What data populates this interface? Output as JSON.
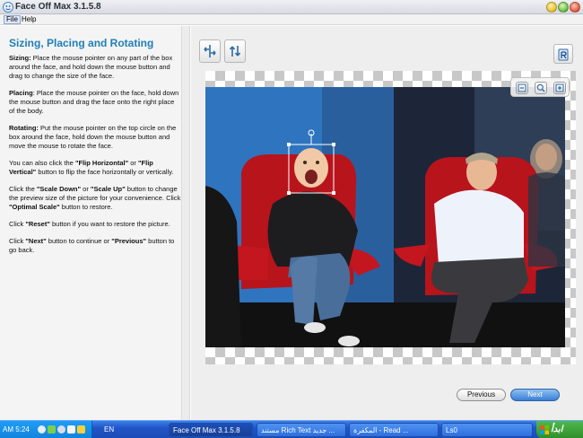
{
  "window": {
    "title": "Face Off Max  3.1.5.8"
  },
  "menu": {
    "items": [
      {
        "label": "File"
      },
      {
        "label": "Help"
      }
    ]
  },
  "help": {
    "title": "Sizing, Placing and Rotating",
    "paragraphs": [
      {
        "bold": "Sizing:",
        "text": " Place the mouse pointer on any part of the box around the face, and hold down the mouse button and drag to change the size of the face."
      },
      {
        "bold": "Placing",
        "text": ": Place the mouse pointer on the face, hold down the mouse button and drag the face onto the right place of the body."
      },
      {
        "bold": "Rotating:",
        "text": " Put the mouse pointer on the top circle on the box around the face, hold down the mouse button and move the mouse to rotate the face."
      },
      {
        "html_parts": [
          "You can also click the ",
          "\"Flip Horizontal\"",
          " or ",
          "\"Flip Vertical\"",
          " button to flip the face horizontally or vertically."
        ]
      },
      {
        "html_parts": [
          "Click the ",
          "\"Scale Down\"",
          " or ",
          "\"Scale Up\"",
          " button to change the preview size of the picture for your convenience. Click ",
          "\"Optimal Scale\"",
          " button to restore."
        ]
      },
      {
        "html_parts": [
          "Click ",
          "\"Reset\"",
          " button if you want to restore the picture."
        ]
      },
      {
        "html_parts": [
          "Click ",
          "\"Next\"",
          " button to continue or ",
          "\"Previous\"",
          " button to go back."
        ]
      }
    ]
  },
  "toolbar": {
    "flip_horizontal_icon": "flip-horizontal-icon",
    "flip_vertical_icon": "flip-vertical-icon",
    "reset_icon": "reset-icon"
  },
  "zoom": {
    "scale_down_icon": "zoom-out-icon",
    "optimal_icon": "zoom-fit-icon",
    "scale_up_icon": "zoom-in-icon"
  },
  "nav": {
    "previous_label": "Previous",
    "next_label": "Next"
  },
  "taskbar": {
    "clock": "AM 5:24",
    "language": "EN",
    "tasks": [
      {
        "label": "Face Off Max  3.1.5.8"
      },
      {
        "label": "مستند Rich Text جديد ..."
      },
      {
        "label": "المكفرة - Read ..."
      },
      {
        "label": "Ls0"
      }
    ],
    "start_label": "ابدأ"
  },
  "colors": {
    "accent_title": "#1f7fb7",
    "next_button": "#3a7fd4",
    "taskbar": "#2155c7",
    "start": "#2f8c2b"
  }
}
